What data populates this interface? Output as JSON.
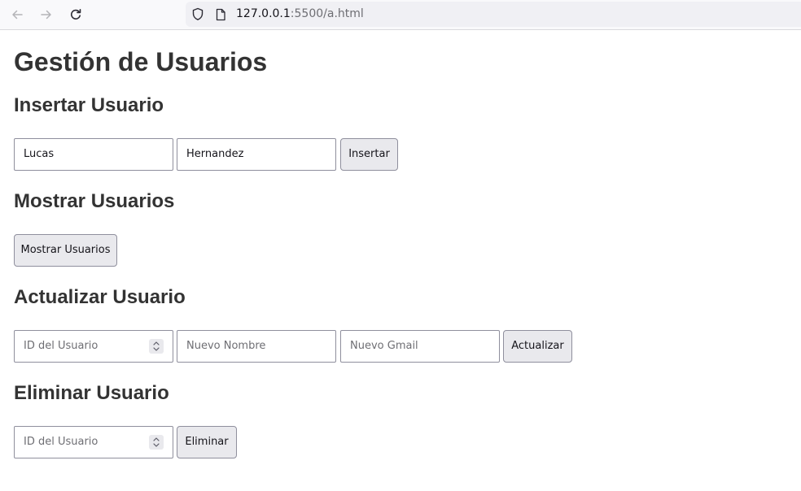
{
  "browser": {
    "url_host": "127.0.0.1",
    "url_rest": ":5500/a.html",
    "icons": [
      "back-arrow-icon",
      "forward-arrow-icon",
      "reload-icon",
      "shield-icon",
      "page-icon"
    ]
  },
  "page_title": "Gestión de Usuarios",
  "insert": {
    "heading": "Insertar Usuario",
    "name_value": "Lucas",
    "lastname_value": "Hernandez",
    "button": "Insertar"
  },
  "show": {
    "heading": "Mostrar Usuarios",
    "button": "Mostrar Usuarios"
  },
  "update": {
    "heading": "Actualizar Usuario",
    "id_placeholder": "ID del Usuario",
    "name_placeholder": "Nuevo Nombre",
    "gmail_placeholder": "Nuevo Gmail",
    "button": "Actualizar"
  },
  "delete": {
    "heading": "Eliminar Usuario",
    "id_placeholder": "ID del Usuario",
    "button": "Eliminar"
  }
}
